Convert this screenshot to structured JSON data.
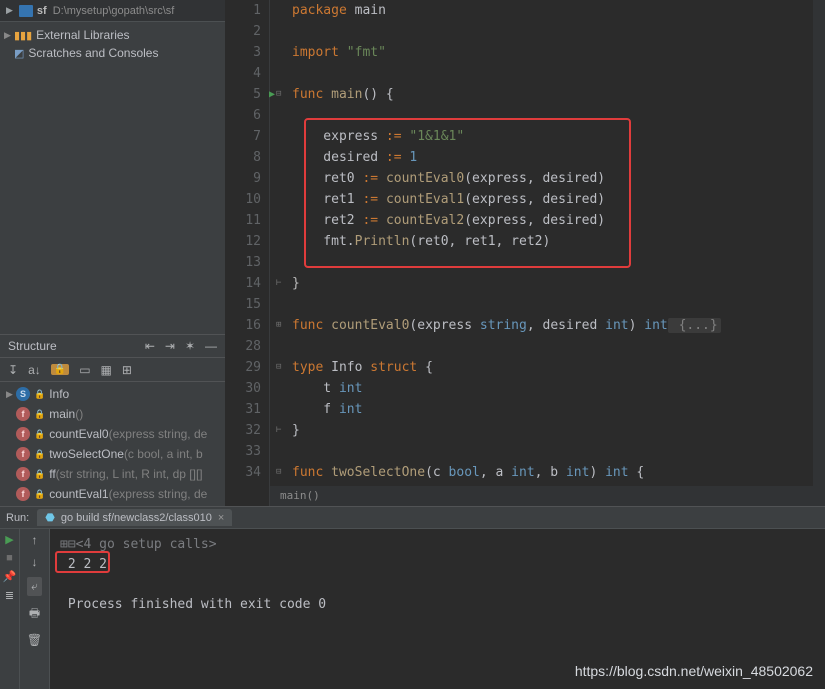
{
  "project": {
    "folder": "sf",
    "path": "D:\\mysetup\\gopath\\src\\sf",
    "tree": {
      "ext_libs": "External Libraries",
      "scratches": "Scratches and Consoles"
    }
  },
  "structure": {
    "title": "Structure",
    "items": [
      {
        "icon": "blue",
        "letter": "S",
        "lock": true,
        "name": "Info",
        "sig": ""
      },
      {
        "icon": "red",
        "letter": "f",
        "lock": true,
        "name": "main",
        "sig": "()"
      },
      {
        "icon": "red",
        "letter": "f",
        "lock": true,
        "name": "countEval0",
        "sig": "(express string, de"
      },
      {
        "icon": "red",
        "letter": "f",
        "lock": true,
        "name": "twoSelectOne",
        "sig": "(c bool, a int, b"
      },
      {
        "icon": "red",
        "letter": "f",
        "lock": true,
        "name": "ff",
        "sig": "(str string, L int, R int, dp [][]"
      },
      {
        "icon": "red",
        "letter": "f",
        "lock": true,
        "name": "countEval1",
        "sig": "(express string, de"
      }
    ]
  },
  "editor": {
    "lines": [
      "1",
      "2",
      "3",
      "4",
      "5",
      "6",
      "7",
      "8",
      "9",
      "10",
      "11",
      "12",
      "13",
      "14",
      "15",
      "16",
      "28",
      "29",
      "30",
      "31",
      "32",
      "33",
      "34"
    ],
    "code": {
      "l1": {
        "kw": "package ",
        "id": "main"
      },
      "l3": {
        "kw": "import ",
        "str": "\"fmt\""
      },
      "l5": {
        "kw": "func ",
        "fn": "main",
        "rest": "() {"
      },
      "l7": {
        "a": "express ",
        "op": ":= ",
        "str": "\"1&1&1\""
      },
      "l8": {
        "a": "desired ",
        "op": ":= ",
        "num": "1"
      },
      "l9": {
        "a": "ret0 ",
        "op": ":= ",
        "fn": "countEval0",
        "args": "(express, desired)"
      },
      "l10": {
        "a": "ret1 ",
        "op": ":= ",
        "fn": "countEval1",
        "args": "(express, desired)"
      },
      "l11": {
        "a": "ret2 ",
        "op": ":= ",
        "fn": "countEval2",
        "args": "(express, desired)"
      },
      "l12": {
        "a": "fmt.",
        "fn": "Println",
        "args": "(ret0, ret1, ret2)"
      },
      "l14": "}",
      "l16": {
        "kw": "func ",
        "fn": "countEval0",
        "p1": "(express ",
        "t1": "string",
        "c1": ", desired ",
        "t2": "int",
        "p2": ") ",
        "ret": "int",
        "fold": " {...}"
      },
      "l29": {
        "kw": "type ",
        "id": "Info ",
        "kw2": "struct",
        "rest": " {"
      },
      "l30": {
        "a": "t ",
        "t": "int"
      },
      "l31": {
        "a": "f ",
        "t": "int"
      },
      "l32": "}",
      "l34": {
        "kw": "func ",
        "fn": "twoSelectOne",
        "p": "(c ",
        "t1": "bool",
        "c1": ", a ",
        "t2": "int",
        "c2": ", b ",
        "t3": "int",
        "p2": ") ",
        "ret": "int",
        "rest": " {"
      }
    },
    "breadcrumb": "main()"
  },
  "run": {
    "label": "Run:",
    "tab": "go build sf/newclass2/class010",
    "console": {
      "setup": "<4 go setup calls>",
      "out": "2 2 2",
      "exit": "Process finished with exit code 0"
    }
  },
  "watermark": "https://blog.csdn.net/weixin_48502062"
}
